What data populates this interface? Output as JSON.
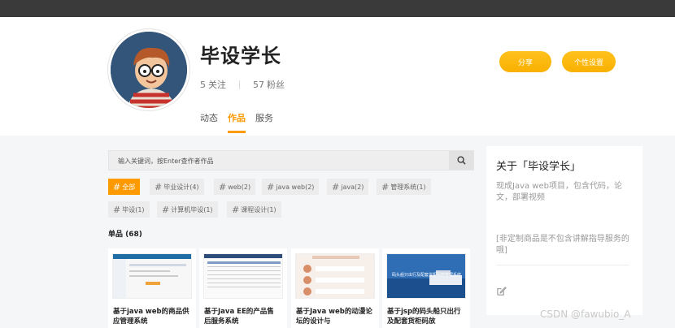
{
  "profile": {
    "name": "毕设学长",
    "follow_count": "5",
    "follow_label": "关注",
    "fans_count": "57",
    "fans_label": "粉丝",
    "tabs": [
      {
        "label": "动态",
        "active": false
      },
      {
        "label": "作品",
        "active": true
      },
      {
        "label": "服务",
        "active": false
      }
    ],
    "share_label": "分享",
    "settings_label": "个性设置"
  },
  "search": {
    "placeholder": "输入关键词，按Enter查作者作品",
    "icon": "search-icon"
  },
  "filters": [
    {
      "label": "全部",
      "active": true
    },
    {
      "label": "毕业设计(4)"
    },
    {
      "label": "web(2)"
    },
    {
      "label": "java web(2)"
    },
    {
      "label": "java(2)"
    },
    {
      "label": "管理系统(1)"
    },
    {
      "label": "毕设(1)"
    },
    {
      "label": "计算机毕设(1)"
    },
    {
      "label": "课程设计(1)"
    }
  ],
  "count_label": "单品 (68)",
  "cards": [
    {
      "title_line1": "基于java web的商品供",
      "title_line2": "应管理系统"
    },
    {
      "title_line1": "基于Java EE的产品售",
      "title_line2": "后服务系统"
    },
    {
      "title_line1": "基于Java web的动漫论",
      "title_line2": "坛的设计与"
    },
    {
      "title_line1": "基于jsp的码头船只出行",
      "title_line2": "及配套货柜码放",
      "thumb_text": "码头船只出行及配套货柜码放管理系统"
    }
  ],
  "aside": {
    "title": "关于「毕设学长」",
    "desc": "现成Java web项目，包含代码，论文，部署视频",
    "note": "[非定制商品是不包含讲解指导服务的哦]",
    "edit_icon": "edit-icon"
  },
  "watermark": "CSDN @fawubio_A",
  "colors": {
    "accent": "#fc9a00",
    "button": "#f9b000"
  }
}
